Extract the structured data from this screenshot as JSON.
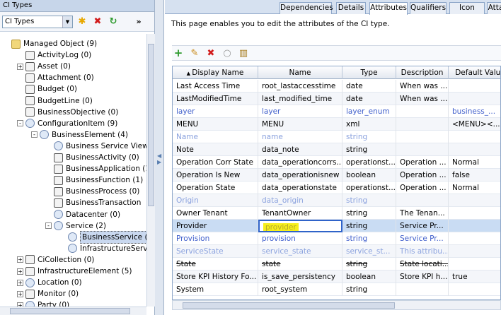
{
  "left_panel": {
    "title": "CI Types",
    "combo_value": "CI Types",
    "toolbar": {
      "new_icon": "✱",
      "delete_icon": "✖",
      "refresh_icon": "↻",
      "more": "»"
    },
    "tree": [
      {
        "label": "Managed Object (9)",
        "level": 0,
        "expander": "",
        "icon": "folder"
      },
      {
        "label": "ActivityLog (0)",
        "level": 1,
        "expander": "",
        "icon": "box"
      },
      {
        "label": "Asset (0)",
        "level": 1,
        "expander": "+",
        "icon": "box"
      },
      {
        "label": "Attachment (0)",
        "level": 1,
        "expander": "",
        "icon": "box"
      },
      {
        "label": "Budget (0)",
        "level": 1,
        "expander": "",
        "icon": "box"
      },
      {
        "label": "BudgetLine (0)",
        "level": 1,
        "expander": "",
        "icon": "box"
      },
      {
        "label": "BusinessObjective (0)",
        "level": 1,
        "expander": "",
        "icon": "box"
      },
      {
        "label": "ConfigurationItem (9)",
        "level": 1,
        "expander": "-",
        "icon": "round"
      },
      {
        "label": "BusinessElement (4)",
        "level": 2,
        "expander": "-",
        "icon": "round"
      },
      {
        "label": "Business Service View",
        "level": 3,
        "expander": "",
        "icon": "round"
      },
      {
        "label": "BusinessActivity (0)",
        "level": 3,
        "expander": "",
        "icon": "box"
      },
      {
        "label": "BusinessApplication (1",
        "level": 3,
        "expander": "",
        "icon": "box"
      },
      {
        "label": "BusinessFunction (1)",
        "level": 3,
        "expander": "",
        "icon": "box"
      },
      {
        "label": "BusinessProcess (0)",
        "level": 3,
        "expander": "",
        "icon": "box"
      },
      {
        "label": "BusinessTransaction",
        "level": 3,
        "expander": "",
        "icon": "box"
      },
      {
        "label": "Datacenter (0)",
        "level": 3,
        "expander": "",
        "icon": "round"
      },
      {
        "label": "Service (2)",
        "level": 3,
        "expander": "-",
        "icon": "round"
      },
      {
        "label": "BusinessService (",
        "level": 4,
        "expander": "",
        "icon": "round",
        "selected": true
      },
      {
        "label": "InfrastructureServ",
        "level": 4,
        "expander": "",
        "icon": "round"
      },
      {
        "label": "CiCollection (0)",
        "level": 1,
        "expander": "+",
        "icon": "box"
      },
      {
        "label": "InfrastructureElement (5)",
        "level": 1,
        "expander": "+",
        "icon": "box"
      },
      {
        "label": "Location (0)",
        "level": 1,
        "expander": "+",
        "icon": "round"
      },
      {
        "label": "Monitor (0)",
        "level": 1,
        "expander": "+",
        "icon": "box"
      },
      {
        "label": "Party (0)",
        "level": 1,
        "expander": "+",
        "icon": "round"
      }
    ]
  },
  "tabs": [
    "Dependencies",
    "Details",
    "Attributes",
    "Qualifiers",
    "Icon",
    "Atta"
  ],
  "active_tab": "Attributes",
  "description": "This page enables you to edit the attributes of the CI type.",
  "grid_toolbar": {
    "add_icon": "+",
    "edit_icon": "✎",
    "delete_icon": "✖",
    "restore_icon": "○",
    "columns_icon": "▥"
  },
  "grid": {
    "columns": [
      "Display Name",
      "Name",
      "Type",
      "Description",
      "Default Value"
    ],
    "sort_indicator": "▲",
    "rows": [
      {
        "cells": [
          "Last Access Time",
          "root_lastaccesstime",
          "date",
          "When was ...",
          ""
        ],
        "style": ""
      },
      {
        "cells": [
          "LastModifiedTime",
          "last_modified_time",
          "date",
          "When was ...",
          ""
        ],
        "style": ""
      },
      {
        "cells": [
          "layer",
          "layer",
          "layer_enum",
          "",
          "business_..."
        ],
        "style": "inh"
      },
      {
        "cells": [
          "MENU",
          "MENU",
          "xml",
          "",
          "<MENU><..."
        ],
        "style": ""
      },
      {
        "cells": [
          "Name",
          "name",
          "string",
          "",
          ""
        ],
        "style": "fade"
      },
      {
        "cells": [
          "Note",
          "data_note",
          "string",
          "",
          ""
        ],
        "style": ""
      },
      {
        "cells": [
          "Operation Corr State",
          "data_operationcorrs...",
          "operationst...",
          "Operation ...",
          "Normal"
        ],
        "style": ""
      },
      {
        "cells": [
          "Operation Is New",
          "data_operationisnew",
          "boolean",
          "Operation ...",
          "false"
        ],
        "style": ""
      },
      {
        "cells": [
          "Operation State",
          "data_operationstate",
          "operationst...",
          "Operation ...",
          "Normal"
        ],
        "style": ""
      },
      {
        "cells": [
          "Origin",
          "data_origin",
          "string",
          "",
          ""
        ],
        "style": "fade"
      },
      {
        "cells": [
          "Owner Tenant",
          "TenantOwner",
          "string",
          "The Tenan...",
          ""
        ],
        "style": ""
      },
      {
        "cells": [
          "Provider",
          "provider",
          "string",
          "Service Pr...",
          ""
        ],
        "style": "selrow"
      },
      {
        "cells": [
          "Provision",
          "provision",
          "string",
          "Service Pr...",
          ""
        ],
        "style": "inh"
      },
      {
        "cells": [
          "ServiceState",
          "service_state",
          "service_st...",
          "This attribu...",
          ""
        ],
        "style": "fade"
      },
      {
        "cells": [
          "State",
          "state",
          "string",
          "State locati...",
          ""
        ],
        "style": "strike"
      },
      {
        "cells": [
          "Store KPI History Fo...",
          "is_save_persistency",
          "boolean",
          "Store KPI h...",
          "true"
        ],
        "style": ""
      },
      {
        "cells": [
          "System",
          "root_system",
          "string",
          "",
          ""
        ],
        "style": ""
      }
    ]
  }
}
